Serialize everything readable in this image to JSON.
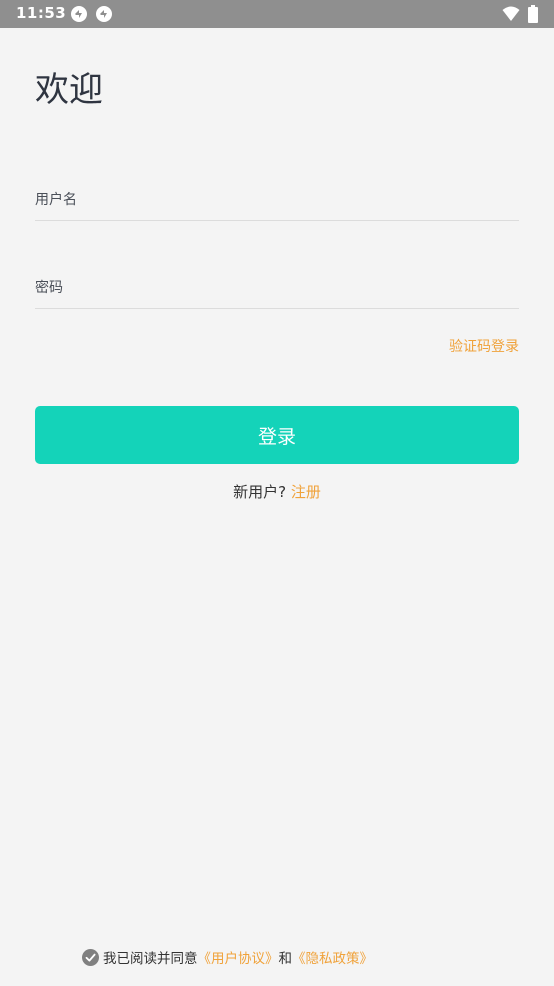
{
  "status_bar": {
    "time": "11:53",
    "icons": [
      "sync-notification-icon",
      "sync-notification-icon",
      "wifi-icon",
      "battery-icon"
    ]
  },
  "login": {
    "title": "欢迎",
    "username_placeholder": "用户名",
    "password_placeholder": "密码",
    "sms_login_label": "验证码登录",
    "login_button_label": "登录",
    "register_prompt": "新用户?",
    "register_link": "注册"
  },
  "agreement": {
    "checked": true,
    "prefix": "我已阅读并同意",
    "user_agreement_link": "《用户协议》",
    "conjunction": "和",
    "privacy_policy_link": "《隐私政策》"
  },
  "colors": {
    "status_bar": "#8f8f8f",
    "background": "#f4f4f4",
    "accent": "#14d3b9",
    "link": "#f0a23a",
    "title_text": "#2f3541"
  }
}
